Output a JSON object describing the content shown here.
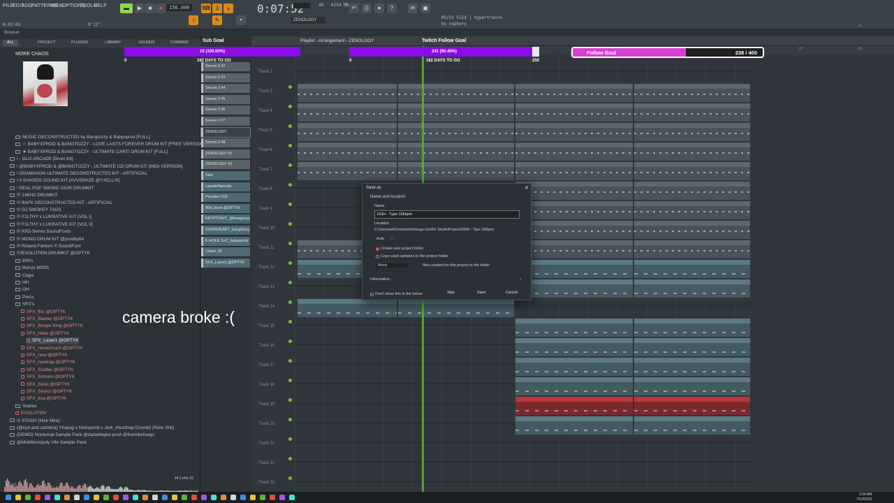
{
  "menu": [
    "FILE",
    "EDIT",
    "ADD",
    "PATTERNS",
    "VIEW",
    "OPTIONS",
    "TOOLS",
    "HELP"
  ],
  "transport": {
    "tempo": "156.000",
    "time": "0:07:52",
    "cpu_mem": "6154 MB",
    "cpu_val": "44",
    "pattern_name": "ZENOLOGY",
    "small_readout": "0:01:03",
    "readout2": "0'12\""
  },
  "plugin_news": {
    "line1": "05/21 FLEX | Hypertrance",
    "line2": "by nuphory"
  },
  "browser": {
    "title": "Browser",
    "tabs": [
      "ALL",
      "PROJECT",
      "PLUGINS",
      "LIBRARY",
      "SOUNDS",
      "STARRED"
    ],
    "folder_title": "MORE CHAOS",
    "items": [
      {
        "label": "MUSIC DECONSTRUCTED by Bangtozzy & Babyxprod [FULL]",
        "indent": 1,
        "type": "folder"
      },
      {
        "label": "☆ BABYXPROD & BANGTOZZY - LOVE LASTS FOREVER DRUM KIT [FREE VERSION]",
        "indent": 1,
        "type": "folder"
      },
      {
        "label": "★ BABYXPROD & BANGTOZZY - ULTIMATE CARTI DRUM KIT [FULL]",
        "indent": 1,
        "type": "folder"
      },
      {
        "label": "! -  GLO ARCADE [Drum Kit]",
        "indent": 0,
        "type": "folder"
      },
      {
        "label": "! @BABYXPROD & @BANGTOZZY - ULTIMATE UZI DRUM KIT [MIDI VERSION]",
        "indent": 0,
        "type": "folder"
      },
      {
        "label": "! OSAMASON ULTIMATE DECONSTRUCTED KIT - ARTIFICIAL",
        "indent": 0,
        "type": "folder"
      },
      {
        "label": "! # SHARDS SOUND KIT [#VVSRAZE @YXELLIX]",
        "indent": 0,
        "type": "folder"
      },
      {
        "label": "! REAL POP SMOKE DIOR DRUMKIT",
        "indent": 0,
        "type": "folder"
      },
      {
        "label": "!!! 14KHZ DRUMKIT",
        "indent": 0,
        "type": "folder"
      },
      {
        "label": "!!! BAFK DECONSTRUCTED KIT - ARTIFICIAL",
        "indent": 0,
        "type": "folder"
      },
      {
        "label": "!!! DJ SMOKEY TAGS",
        "indent": 0,
        "type": "folder"
      },
      {
        "label": "!!! F1LTHY x LUKRATIVE KIT [VOL I]",
        "indent": 0,
        "type": "folder"
      },
      {
        "label": "!!! F1LTHY x LUKRATIVE KIT [VOL II]",
        "indent": 0,
        "type": "folder"
      },
      {
        "label": "!!! KR2-Series SoundFonts",
        "indent": 0,
        "type": "folder"
      },
      {
        "label": "!!! MONO DRUM KIT @prodby64",
        "indent": 0,
        "type": "folder"
      },
      {
        "label": "!!! Roland Fantom X SoundFont",
        "indent": 0,
        "type": "folder"
      },
      {
        "label": "!!!!EVOLUTI0N DRUMKIT @OPTYK",
        "indent": 0,
        "type": "open"
      },
      {
        "label": "808's",
        "indent": 1,
        "type": "folder"
      },
      {
        "label": "Bonus MIDIS",
        "indent": 1,
        "type": "folder"
      },
      {
        "label": "Claps",
        "indent": 1,
        "type": "folder"
      },
      {
        "label": "HH",
        "indent": 1,
        "type": "folder"
      },
      {
        "label": "OH",
        "indent": 1,
        "type": "folder"
      },
      {
        "label": "Percs",
        "indent": 1,
        "type": "folder"
      },
      {
        "label": "SFX's",
        "indent": 1,
        "type": "open"
      },
      {
        "label": "SFX_Bio @OPTYK",
        "indent": 2,
        "type": "file"
      },
      {
        "label": "SFX_Blaster @OPTYK",
        "indent": 2,
        "type": "file"
      },
      {
        "label": "SFX_Burger King @OPTYK",
        "indent": 2,
        "type": "file"
      },
      {
        "label": "SFX_Hella @OPTYK",
        "indent": 2,
        "type": "file"
      },
      {
        "label": "SFX_Laser1 @OPTYK",
        "indent": 3,
        "type": "selected"
      },
      {
        "label": "SFX_nova2much @OPTYK",
        "indent": 2,
        "type": "file"
      },
      {
        "label": "SFX_new @OPTYK",
        "indent": 2,
        "type": "file"
      },
      {
        "label": "SFX_newtrap @OPTYK",
        "indent": 2,
        "type": "file"
      },
      {
        "label": "SFX_Scatter @OPTYK",
        "indent": 2,
        "type": "file"
      },
      {
        "label": "SFX_Scream @OPTYK",
        "indent": 2,
        "type": "file"
      },
      {
        "label": "SFX_Siren @OPTYK",
        "indent": 2,
        "type": "file"
      },
      {
        "label": "SFX_Siren2 @OPTYK",
        "indent": 2,
        "type": "file"
      },
      {
        "label": "SFX_tina @OPTYK",
        "indent": 2,
        "type": "file"
      },
      {
        "label": "Snares",
        "indent": 1,
        "type": "folder"
      },
      {
        "label": "EVOLUTI0N",
        "indent": 1,
        "type": "file"
      },
      {
        "label": "!1 STASH (Nick Mira)",
        "indent": 0,
        "type": "folder"
      },
      {
        "label": "(@kyd.and.cambria) Yhapojj x Nettspend x Jerk_Hoodtrap Drumkit (Rare Shit)",
        "indent": 0,
        "type": "folder"
      },
      {
        "label": "(DEMO) Nocturnal Sample Pack @danieltaylor.prod @themikefuego",
        "indent": 0,
        "type": "folder"
      },
      {
        "label": "@MobMonopoly Vile Sample Pack",
        "indent": 0,
        "type": "folder"
      }
    ],
    "sample_info": "44.1 kHz 16",
    "tags_label": "TAGS"
  },
  "overlay_text": "camera broke :(",
  "goals": {
    "sub_goal_title": "Sub Goal",
    "sub_goal_value": "10 (100.00%)",
    "sub_goal_start": "0",
    "sub_goal_days": "162 DAYS TO GO",
    "twitch_title": "Twitch Follow Goal",
    "twitch_value": "241 (96.40%)",
    "twitch_start": "0",
    "twitch_days": "162 DAYS TO GO",
    "twitch_end": "250",
    "twitch_progress": 0.964,
    "follow_title": "Follow Goal",
    "follow_count": "238 / 400",
    "follow_progress": 0.595,
    "colors": {
      "purple": "#8a0ce6",
      "magenta": "#d63fd0"
    }
  },
  "patterns": [
    {
      "label": "Serum 2 #2",
      "kind": "pattern"
    },
    {
      "label": "Serum 2 #3",
      "kind": "pattern"
    },
    {
      "label": "Serum 2 #4",
      "kind": "pattern"
    },
    {
      "label": "Serum 2 #5",
      "kind": "pattern"
    },
    {
      "label": "Serum 2 #6",
      "kind": "pattern"
    },
    {
      "label": "Serum 2 #7",
      "kind": "pattern"
    },
    {
      "label": "ZENOLOGY",
      "kind": "active"
    },
    {
      "label": "Serum 2 #8",
      "kind": "pattern"
    },
    {
      "label": "ZENOLOGY #2",
      "kind": "pattern"
    },
    {
      "label": "ZENOLOGY #3",
      "kind": "pattern"
    },
    {
      "label": "Sitar",
      "kind": "audio"
    },
    {
      "label": "LiquidoNarcotic",
      "kind": "audio"
    },
    {
      "label": "Parallax VCF",
      "kind": "audio"
    },
    {
      "label": "808_blunt @OPTYK",
      "kind": "audio"
    },
    {
      "label": "KRYPTONIT_@bangtozzy",
      "kind": "audio"
    },
    {
      "label": "DOWN2EART_bangtozzy",
      "kind": "audio"
    },
    {
      "label": "K-HOLE SnC_babyxprod",
      "kind": "audio"
    },
    {
      "label": "Chant_05",
      "kind": "audio"
    },
    {
      "label": "SFX_Laser1 @OPTYK",
      "kind": "audio"
    }
  ],
  "playlist": {
    "title": "Playlist - Arrangement › ZENOLOGY",
    "tracks": [
      "Track 2",
      "Track 3",
      "Track 4",
      "Track 5",
      "Track 6",
      "Track 7",
      "Track 8",
      "Track 9",
      "Track 10",
      "Track 11",
      "Track 12",
      "Track 13",
      "Track 14",
      "Track 15",
      "Track 16",
      "Track 17",
      "Track 18",
      "Track 19",
      "Track 20",
      "Track 21",
      "Track 22",
      "Track 23"
    ],
    "ruler_marks": [
      "5",
      "9",
      "13",
      "17",
      "21"
    ]
  },
  "clips": [
    {
      "track": 1,
      "segments": [
        0,
        1,
        2,
        3
      ],
      "name": "Serum 2 #3",
      "kind": "midi"
    },
    {
      "track": 2,
      "segments": [
        0,
        1,
        2,
        3
      ],
      "name": "Serum 2 #4",
      "kind": "midi"
    },
    {
      "track": 3,
      "segments": [
        0,
        1,
        2,
        3
      ],
      "name": "Serum 2 #5",
      "kind": "midi"
    },
    {
      "track": 4,
      "segments": [
        0,
        1,
        2,
        3
      ],
      "name": "Serum 2 #6",
      "kind": "midi"
    },
    {
      "track": 5,
      "segments": [
        0,
        1,
        2,
        3
      ],
      "name": "Serum 2 #7",
      "kind": "midi"
    },
    {
      "track": 6,
      "segments": [
        2,
        3
      ],
      "name": "ZENOLOGY",
      "kind": "midi"
    },
    {
      "track": 7,
      "segments": [
        2,
        3
      ],
      "name": "Serum 2 #8",
      "kind": "midi"
    },
    {
      "track": 8,
      "segments": [
        2,
        3
      ],
      "name": "ZENOLOGY #2",
      "kind": "midi"
    },
    {
      "track": 9,
      "segments": [
        0,
        1,
        2,
        3
      ],
      "name": "ZENOLOGY #3",
      "kind": "midi"
    },
    {
      "track": 10,
      "segments": [
        0,
        1,
        2,
        3
      ],
      "name": "Sitar",
      "kind": "audio"
    },
    {
      "track": 11,
      "segments": [
        2,
        3
      ],
      "name": "LiquidoNarcotic",
      "kind": "audio"
    },
    {
      "track": 12,
      "segments": [
        0,
        1
      ],
      "name": "Parallax VCF",
      "kind": "audio"
    },
    {
      "track": 13,
      "segments": [
        2,
        3
      ],
      "name": "808_blunt @OPTYK",
      "kind": "audio"
    },
    {
      "track": 14,
      "segments": [
        2,
        3
      ],
      "name": "KRYPTONIT Hat @bangtozzy",
      "kind": "audio"
    },
    {
      "track": 15,
      "segments": [
        2,
        3
      ],
      "name": "DOWN2EARTH Snare Main @bangtozzy",
      "kind": "audio"
    },
    {
      "track": 16,
      "segments": [
        2,
        3
      ],
      "name": "K-HOLE SnClap Main @babyxprod",
      "kind": "audio"
    },
    {
      "track": 17,
      "segments": [
        2,
        3
      ],
      "name": "Chant_05",
      "kind": "red"
    },
    {
      "track": 18,
      "segments": [
        2,
        3
      ],
      "name": "SFX_Laser1 @OPTYK",
      "kind": "audio"
    }
  ],
  "dialog": {
    "title": "Save as",
    "section": "Name and location",
    "name_label": "Name",
    "name_value": "DGH - Type 156bpm",
    "location_label": "Location",
    "location_value": "C:\\Users\\eek\\Documents\\Image-Line\\FL Studio\\Projects\\DGH - Type 156bpm",
    "auto_label": "Auto",
    "opt1": "Create new project folder",
    "opt2": "Copy used samples to the project folder",
    "move_label": "Move",
    "move_desc": "files created for this project to the folder",
    "info_label": "Information...",
    "dont_show": "Don't show this in the future",
    "skip": "Skip",
    "save": "Save",
    "cancel": "Cancel"
  },
  "clock": {
    "time": "3:24 AM",
    "date": "7/22/2023"
  }
}
